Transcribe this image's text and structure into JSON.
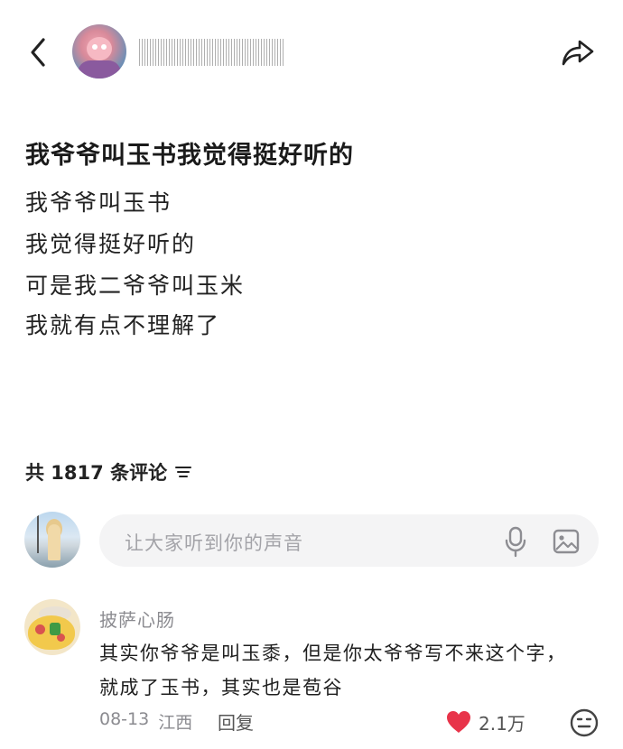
{
  "header": {
    "back_icon": "chevron-left-icon",
    "share_icon": "share-icon"
  },
  "post": {
    "title": "我爷爷叫玉书我觉得挺好听的",
    "lines": [
      "我爷爷叫玉书",
      "我觉得挺好听的",
      "可是我二爷爷叫玉米",
      "我就有点不理解了"
    ]
  },
  "comments_header": {
    "count_label": "共 1817 条评论",
    "sort_icon": "sort-lines-icon"
  },
  "comment_input": {
    "placeholder": "让大家听到你的声音",
    "mic_icon": "microphone-icon",
    "image_icon": "image-icon"
  },
  "comment": {
    "author": "披萨心肠",
    "lines": [
      "其实你爷爷是叫玉黍，但是你太爷爷写不来这个字，",
      "就成了玉书，其实也是苞谷"
    ],
    "date": "08-13",
    "location": "江西",
    "reply_label": "回复",
    "likes": "2.1万",
    "like_color": "#e8344a"
  }
}
